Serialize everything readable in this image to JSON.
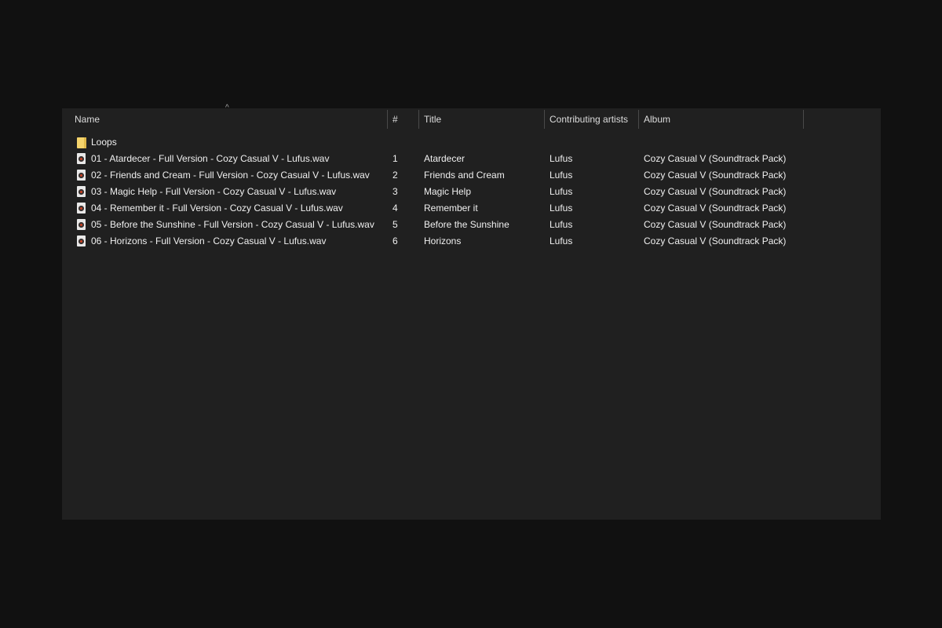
{
  "columns": {
    "name": "Name",
    "number": "#",
    "title": "Title",
    "artists": "Contributing artists",
    "album": "Album"
  },
  "folder": {
    "name": "Loops"
  },
  "files": [
    {
      "name": "01 - Atardecer - Full Version - Cozy Casual V - Lufus.wav",
      "number": "1",
      "title": "Atardecer",
      "artist": "Lufus",
      "album": "Cozy Casual V (Soundtrack Pack)"
    },
    {
      "name": "02 - Friends and Cream - Full Version - Cozy Casual V - Lufus.wav",
      "number": "2",
      "title": "Friends and Cream",
      "artist": "Lufus",
      "album": "Cozy Casual V (Soundtrack Pack)"
    },
    {
      "name": "03 - Magic Help - Full Version - Cozy Casual V - Lufus.wav",
      "number": "3",
      "title": "Magic Help",
      "artist": "Lufus",
      "album": "Cozy Casual V (Soundtrack Pack)"
    },
    {
      "name": "04 - Remember it - Full Version - Cozy Casual V - Lufus.wav",
      "number": "4",
      "title": "Remember it",
      "artist": "Lufus",
      "album": "Cozy Casual V (Soundtrack Pack)"
    },
    {
      "name": "05 - Before the Sunshine - Full Version - Cozy Casual V - Lufus.wav",
      "number": "5",
      "title": "Before the Sunshine",
      "artist": "Lufus",
      "album": "Cozy Casual V (Soundtrack Pack)"
    },
    {
      "name": "06 - Horizons - Full Version - Cozy Casual V - Lufus.wav",
      "number": "6",
      "title": "Horizons",
      "artist": "Lufus",
      "album": "Cozy Casual V (Soundtrack Pack)"
    }
  ]
}
